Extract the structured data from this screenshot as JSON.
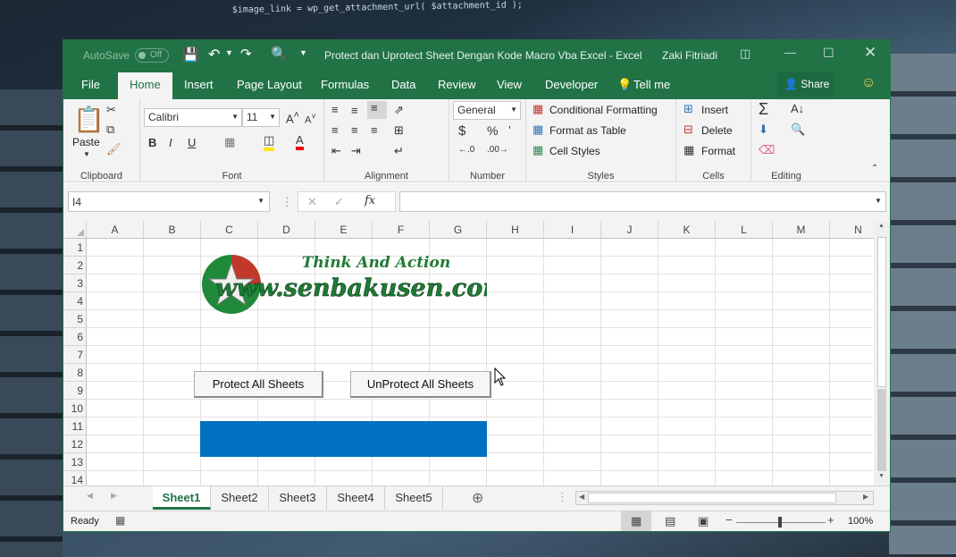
{
  "bg_code": "$image_link = wp_get_attachment_url( $attachment_id );",
  "qat": {
    "autosave_label": "AutoSave",
    "autosave_state": "Off"
  },
  "window": {
    "title": "Protect dan Uprotect Sheet Dengan Kode Macro Vba Excel  -  Excel",
    "user": "Zaki Fitriadi"
  },
  "tabs": [
    "File",
    "Home",
    "Insert",
    "Page Layout",
    "Formulas",
    "Data",
    "Review",
    "View",
    "Developer"
  ],
  "tell_me": "Tell me",
  "share": "Share",
  "ribbon": {
    "clipboard": {
      "paste": "Paste",
      "label": "Clipboard"
    },
    "font": {
      "name": "Calibri",
      "size": "11",
      "label": "Font",
      "bold": "B",
      "italic": "I",
      "underline": "U"
    },
    "alignment": {
      "label": "Alignment"
    },
    "number": {
      "format": "General",
      "label": "Number",
      "currency": "$",
      "percent": "%"
    },
    "styles": {
      "conditional": "Conditional Formatting",
      "table": "Format as Table",
      "cell": "Cell Styles",
      "label": "Styles"
    },
    "cells": {
      "insert": "Insert",
      "delete": "Delete",
      "format": "Format",
      "label": "Cells"
    },
    "editing": {
      "label": "Editing"
    }
  },
  "formula_bar": {
    "name_box": "I4",
    "fx": "fx",
    "formula": ""
  },
  "columns": [
    "A",
    "B",
    "C",
    "D",
    "E",
    "F",
    "G",
    "H",
    "I",
    "J",
    "K",
    "L",
    "M",
    "N"
  ],
  "rows": [
    "1",
    "2",
    "3",
    "4",
    "5",
    "6",
    "7",
    "8",
    "9",
    "10",
    "11",
    "12",
    "13",
    "14"
  ],
  "logo": {
    "tagline": "Think And Action",
    "url": "www.senbakusen.com"
  },
  "buttons": {
    "protect": "Protect All Sheets",
    "unprotect": "UnProtect All Sheets"
  },
  "fill_color": "#0070c0",
  "sheets": [
    "Sheet1",
    "Sheet2",
    "Sheet3",
    "Sheet4",
    "Sheet5"
  ],
  "active_sheet": "Sheet1",
  "status": {
    "ready": "Ready",
    "zoom": "100%"
  }
}
